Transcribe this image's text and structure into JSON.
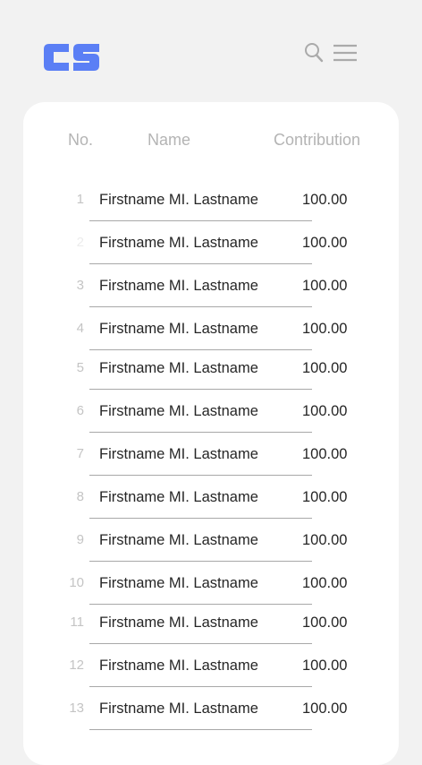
{
  "brand": {
    "logo_text": "CS",
    "accent": "#5b7ff5"
  },
  "header": {
    "search_icon": "search-icon",
    "menu_icon": "menu-icon"
  },
  "table": {
    "columns": {
      "no": "No.",
      "name": "Name",
      "contribution": "Contribution"
    },
    "rows": [
      {
        "no": "1",
        "name": "Firstname MI. Lastname",
        "amount": "100.00"
      },
      {
        "no": "2",
        "name": "Firstname MI. Lastname",
        "amount": "100.00"
      },
      {
        "no": "3",
        "name": "Firstname MI. Lastname",
        "amount": "100.00"
      },
      {
        "no": "4",
        "name": "Firstname MI. Lastname",
        "amount": "100.00"
      },
      {
        "no": "5",
        "name": "Firstname MI. Lastname",
        "amount": "100.00"
      },
      {
        "no": "6",
        "name": "Firstname MI. Lastname",
        "amount": "100.00"
      },
      {
        "no": "7",
        "name": "Firstname MI. Lastname",
        "amount": "100.00"
      },
      {
        "no": "8",
        "name": "Firstname MI. Lastname",
        "amount": "100.00"
      },
      {
        "no": "9",
        "name": "Firstname MI. Lastname",
        "amount": "100.00"
      },
      {
        "no": "10",
        "name": "Firstname MI. Lastname",
        "amount": "100.00"
      },
      {
        "no": "11",
        "name": "Firstname MI. Lastname",
        "amount": "100.00"
      },
      {
        "no": "12",
        "name": "Firstname MI. Lastname",
        "amount": "100.00"
      },
      {
        "no": "13",
        "name": "Firstname MI. Lastname",
        "amount": "100.00"
      }
    ]
  }
}
